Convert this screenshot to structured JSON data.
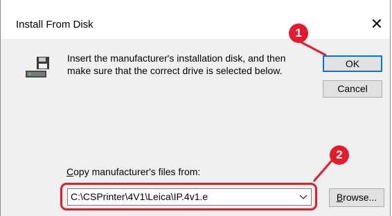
{
  "window": {
    "title": "Install From Disk",
    "close_glyph": "✕"
  },
  "content": {
    "instruction": "Insert the manufacturer's installation disk, and then make sure that the correct drive is selected below.",
    "copy_label_prefix": "",
    "copy_label_accel": "C",
    "copy_label_rest": "opy manufacturer's files from:",
    "path_value": "C:\\CSPrinter\\4V1\\Leica\\IP.4v1.e"
  },
  "buttons": {
    "ok": "OK",
    "cancel": "Cancel",
    "browse_accel": "B",
    "browse_rest": "rowse..."
  },
  "annotations": {
    "badge1": "1",
    "badge2": "2",
    "color": "#e31b2b"
  },
  "icons": {
    "disk": "floppy-drive-icon",
    "dropdown": "chevron-down-icon",
    "close": "close-icon"
  }
}
